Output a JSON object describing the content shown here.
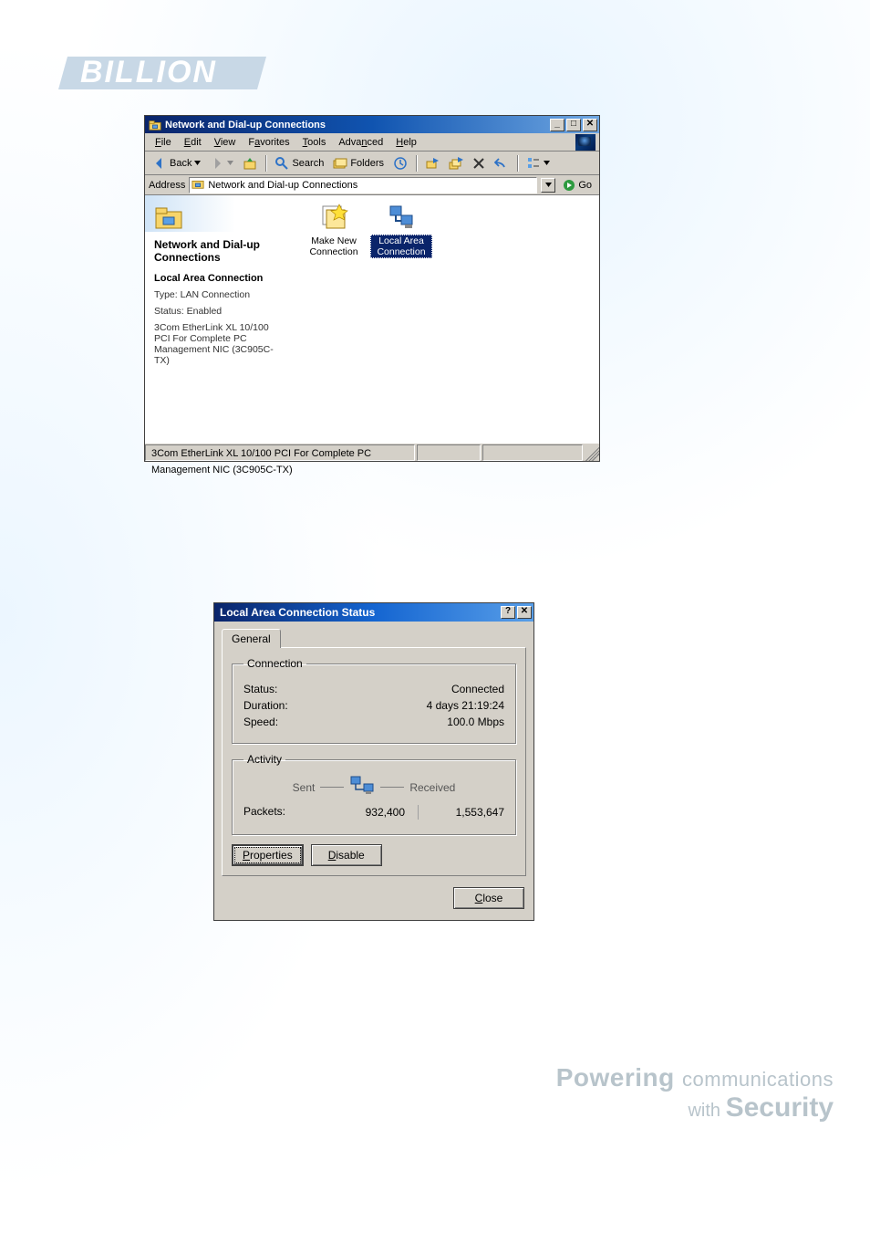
{
  "brand": {
    "name": "BILLION"
  },
  "footer": {
    "line1_a": "Powering",
    "line1_b": "communications",
    "line2_a": "with",
    "line2_b": "Security"
  },
  "explorer": {
    "title": "Network and Dial-up Connections",
    "menus": {
      "file": "File",
      "edit": "Edit",
      "view": "View",
      "favorites": "Favorites",
      "tools": "Tools",
      "advanced": "Advanced",
      "help": "Help"
    },
    "toolbar": {
      "back": "Back",
      "search": "Search",
      "folders": "Folders",
      "history_tip": "History",
      "move_to_tip": "Move To",
      "copy_to_tip": "Copy To",
      "delete_tip": "Delete",
      "undo_tip": "Undo",
      "views_tip": "Views"
    },
    "addressbar": {
      "label": "Address",
      "value": "Network and Dial-up Connections",
      "go": "Go"
    },
    "left_panel": {
      "heading": "Network and Dial-up Connections",
      "section": "Local Area Connection",
      "type_line": "Type: LAN Connection",
      "status_line": "Status: Enabled",
      "nic_line": "3Com EtherLink XL 10/100 PCI For Complete PC Management NIC (3C905C-TX)"
    },
    "icons": {
      "make_new": "Make New Connection",
      "lac": "Local Area Connection"
    },
    "statusbar": {
      "main": "3Com EtherLink XL 10/100 PCI For Complete PC Management NIC (3C905C-TX)"
    }
  },
  "dialog": {
    "title": "Local Area Connection Status",
    "tab_general": "General",
    "group_connection": "Connection",
    "status_label": "Status:",
    "status_value": "Connected",
    "duration_label": "Duration:",
    "duration_value": "4 days 21:19:24",
    "speed_label": "Speed:",
    "speed_value": "100.0 Mbps",
    "group_activity": "Activity",
    "sent_label": "Sent",
    "received_label": "Received",
    "packets_label": "Packets:",
    "packets_sent": "932,400",
    "packets_received": "1,553,647",
    "btn_properties": "Properties",
    "btn_disable": "Disable",
    "btn_close": "Close"
  }
}
